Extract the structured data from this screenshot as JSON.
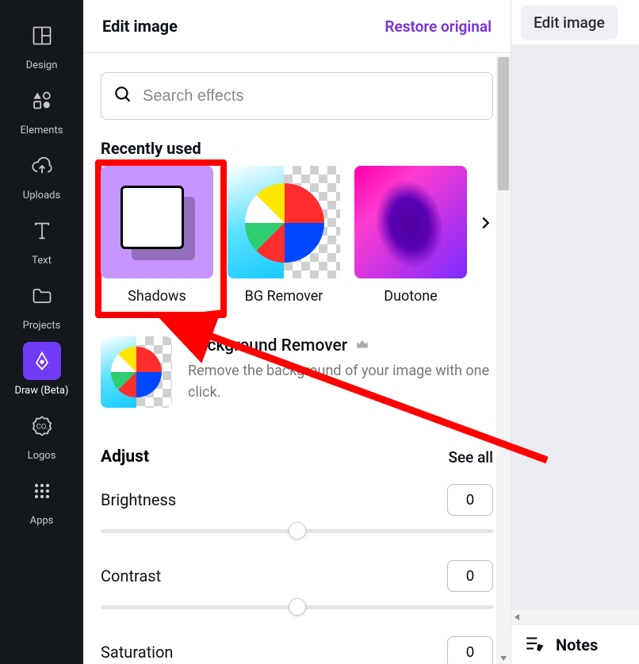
{
  "sidebar": {
    "items": [
      {
        "label": "Design"
      },
      {
        "label": "Elements"
      },
      {
        "label": "Uploads"
      },
      {
        "label": "Text"
      },
      {
        "label": "Projects"
      },
      {
        "label": "Draw (Beta)"
      },
      {
        "label": "Logos"
      },
      {
        "label": "Apps"
      }
    ]
  },
  "panel": {
    "title": "Edit image",
    "restore": "Restore original",
    "search_placeholder": "Search effects",
    "recent_title": "Recently used",
    "effects": [
      {
        "label": "Shadows"
      },
      {
        "label": "BG Remover"
      },
      {
        "label": "Duotone"
      }
    ],
    "bg_remover": {
      "title": "Background Remover",
      "desc": "Remove the background of your image with one click."
    },
    "adjust": {
      "title": "Adjust",
      "see_all": "See all",
      "sliders": [
        {
          "label": "Brightness",
          "value": "0"
        },
        {
          "label": "Contrast",
          "value": "0"
        },
        {
          "label": "Saturation",
          "value": "0"
        }
      ]
    }
  },
  "right": {
    "edit_button": "Edit image",
    "notes": "Notes"
  }
}
